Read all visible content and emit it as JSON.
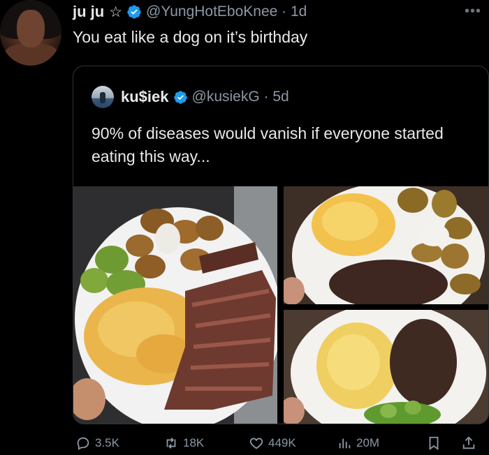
{
  "post": {
    "display_name": "ju ju",
    "handle_time": "@YungHotEboKnee · 1d",
    "text": "You eat like a dog on it’s birthday",
    "badge_icon": "star-outline-icon",
    "verified_color": "#1d9bf0"
  },
  "quote": {
    "display_name": "ku$iek",
    "handle_time": "@kusiekG · 5d",
    "text": "90% of diseases would vanish if everyone started eating this way...",
    "images": [
      "food-plate-steak-eggs-potatoes-avocado",
      "food-plate-eggs-ground-beef-potatoes",
      "food-plate-eggs-ground-beef-cucumber"
    ]
  },
  "actions": {
    "replies": "3.5K",
    "reposts": "18K",
    "likes": "449K",
    "views": "20M"
  },
  "colors": {
    "background": "#000000",
    "text": "#e7e9ea",
    "muted": "#8b98a5",
    "border": "#2f3336"
  }
}
